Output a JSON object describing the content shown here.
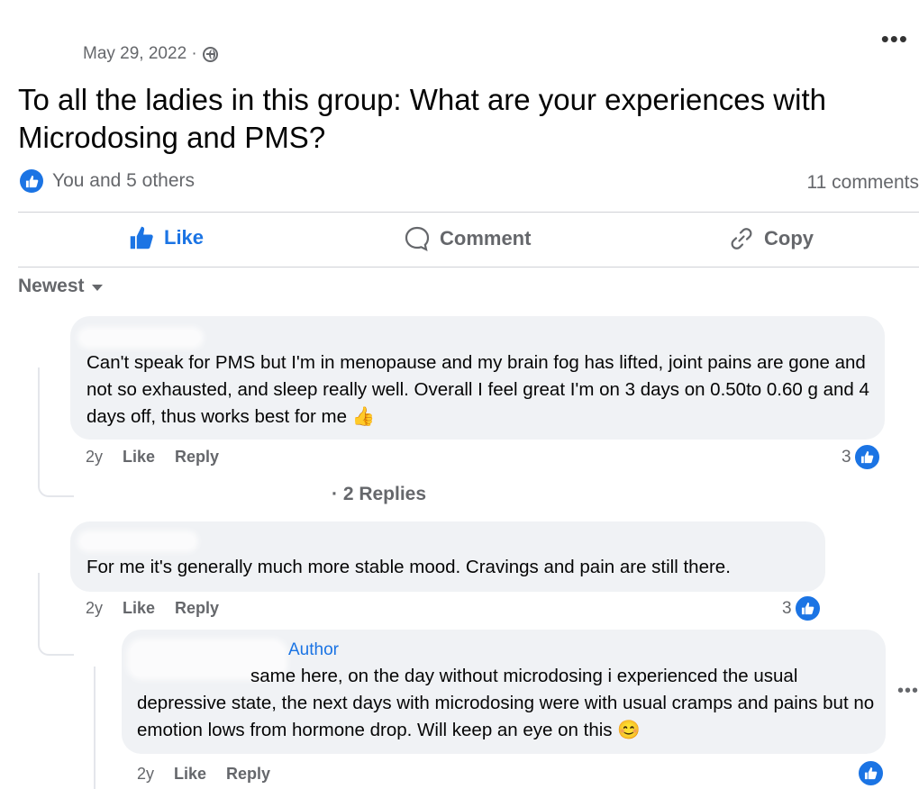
{
  "post": {
    "date": "May 29, 2022 ·",
    "more_icon": "•••",
    "title": "To all the ladies in this group: What are your experiences with Microdosing and PMS?",
    "reactions_text": "You and 5 others",
    "comments_count": "11 comments"
  },
  "actions": {
    "like": "Like",
    "comment": "Comment",
    "copy": "Copy"
  },
  "sort": {
    "label": "Newest"
  },
  "comments": [
    {
      "text": "Can't speak for PMS but I'm in menopause and my brain fog has lifted, joint pains are gone and not so exhausted, and sleep really well. Overall I feel great I'm on 3 days on 0.50to 0.60 g and 4 days off, thus works best for me 👍",
      "time": "2y",
      "like": "Like",
      "reply": "Reply",
      "reaction_count": "3",
      "replies_link": "· 2 Replies"
    },
    {
      "text": "For me it's generally much more stable mood. Cravings and pain are still there.",
      "time": "2y",
      "like": "Like",
      "reply": "Reply",
      "reaction_count": "3"
    },
    {
      "author_badge": "Author",
      "text": "same here, on the day without microdosing i experienced the usual depressive state, the next days with microdosing were with usual cramps and pains but no emotion lows from hormone drop. Will keep an eye on this 😊",
      "time": "2y",
      "like": "Like",
      "reply": "Reply",
      "side_menu": "•••"
    }
  ],
  "colors": {
    "accent": "#1b74e4",
    "muted": "#65676b",
    "bubble": "#f0f2f5"
  }
}
